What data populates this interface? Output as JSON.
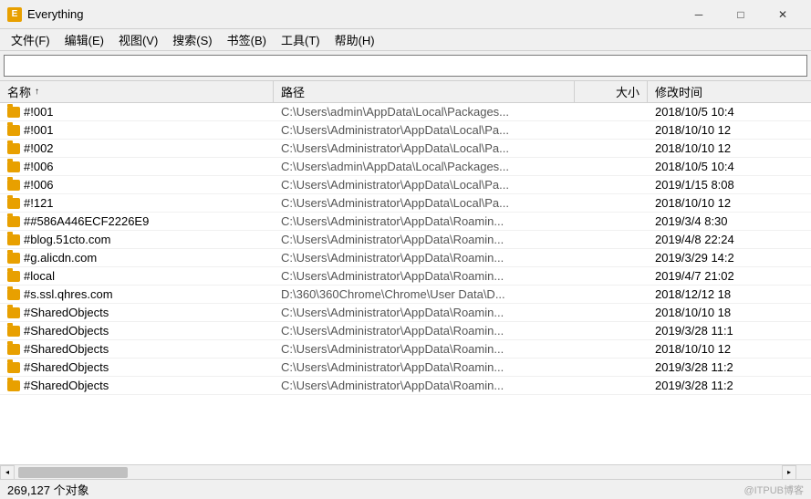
{
  "titleBar": {
    "title": "Everything",
    "iconLabel": "E",
    "minimizeLabel": "─",
    "maximizeLabel": "□",
    "closeLabel": "✕"
  },
  "menuBar": {
    "items": [
      {
        "label": "文件(F)"
      },
      {
        "label": "编辑(E)"
      },
      {
        "label": "视图(V)"
      },
      {
        "label": "搜索(S)"
      },
      {
        "label": "书签(B)"
      },
      {
        "label": "工具(T)"
      },
      {
        "label": "帮助(H)"
      }
    ]
  },
  "search": {
    "placeholder": "",
    "value": ""
  },
  "tableHeader": {
    "nameCol": "名称",
    "pathCol": "路径",
    "sizeCol": "大小",
    "dateCol": "修改时间",
    "sortArrow": "↑"
  },
  "rows": [
    {
      "name": "#!001",
      "path": "C:\\Users\\admin\\AppData\\Local\\Packages...",
      "size": "",
      "date": "2018/10/5 10:4"
    },
    {
      "name": "#!001",
      "path": "C:\\Users\\Administrator\\AppData\\Local\\Pa...",
      "size": "",
      "date": "2018/10/10 12"
    },
    {
      "name": "#!002",
      "path": "C:\\Users\\Administrator\\AppData\\Local\\Pa...",
      "size": "",
      "date": "2018/10/10 12"
    },
    {
      "name": "#!006",
      "path": "C:\\Users\\admin\\AppData\\Local\\Packages...",
      "size": "",
      "date": "2018/10/5 10:4"
    },
    {
      "name": "#!006",
      "path": "C:\\Users\\Administrator\\AppData\\Local\\Pa...",
      "size": "",
      "date": "2019/1/15 8:08"
    },
    {
      "name": "#!121",
      "path": "C:\\Users\\Administrator\\AppData\\Local\\Pa...",
      "size": "",
      "date": "2018/10/10 12"
    },
    {
      "name": "##586A446ECF2226E9",
      "path": "C:\\Users\\Administrator\\AppData\\Roamin...",
      "size": "",
      "date": "2019/3/4 8:30"
    },
    {
      "name": "#blog.51cto.com",
      "path": "C:\\Users\\Administrator\\AppData\\Roamin...",
      "size": "",
      "date": "2019/4/8 22:24"
    },
    {
      "name": "#g.alicdn.com",
      "path": "C:\\Users\\Administrator\\AppData\\Roamin...",
      "size": "",
      "date": "2019/3/29 14:2"
    },
    {
      "name": "#local",
      "path": "C:\\Users\\Administrator\\AppData\\Roamin...",
      "size": "",
      "date": "2019/4/7 21:02"
    },
    {
      "name": "#s.ssl.qhres.com",
      "path": "D:\\360\\360Chrome\\Chrome\\User Data\\D...",
      "size": "",
      "date": "2018/12/12 18"
    },
    {
      "name": "#SharedObjects",
      "path": "C:\\Users\\Administrator\\AppData\\Roamin...",
      "size": "",
      "date": "2018/10/10 18"
    },
    {
      "name": "#SharedObjects",
      "path": "C:\\Users\\Administrator\\AppData\\Roamin...",
      "size": "",
      "date": "2019/3/28 11:1"
    },
    {
      "name": "#SharedObjects",
      "path": "C:\\Users\\Administrator\\AppData\\Roamin...",
      "size": "",
      "date": "2018/10/10 12"
    },
    {
      "name": "#SharedObjects",
      "path": "C:\\Users\\Administrator\\AppData\\Roamin...",
      "size": "",
      "date": "2019/3/28 11:2"
    },
    {
      "name": "#SharedObjects",
      "path": "C:\\Users\\Administrator\\AppData\\Roamin...",
      "size": "",
      "date": "2019/3/28 11:2"
    }
  ],
  "statusBar": {
    "count": "269,127 个对象",
    "watermark": "@ITPUB博客"
  }
}
